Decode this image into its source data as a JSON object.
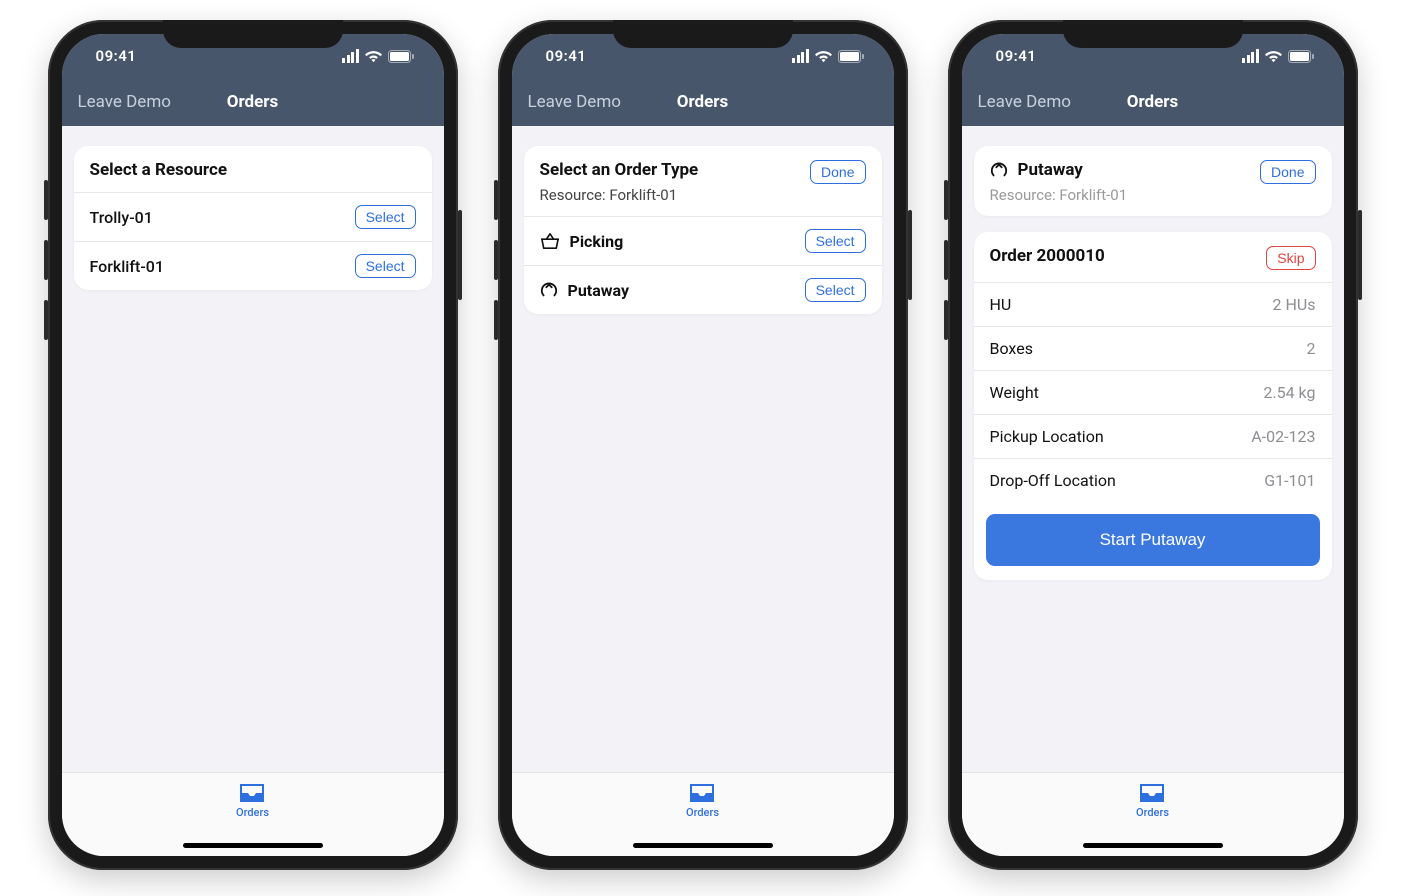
{
  "status": {
    "time": "09:41"
  },
  "nav": {
    "back": "Leave Demo",
    "title": "Orders"
  },
  "tab": {
    "label": "Orders"
  },
  "colors": {
    "accent": "#2e6fe0",
    "danger": "#e0443e",
    "navBg": "#48566b"
  },
  "screen1": {
    "title": "Select a Resource",
    "items": [
      {
        "label": "Trolly-01",
        "action": "Select"
      },
      {
        "label": "Forklift-01",
        "action": "Select"
      }
    ]
  },
  "screen2": {
    "title": "Select an Order Type",
    "resourceLine": "Resource: Forklift-01",
    "done": "Done",
    "types": [
      {
        "icon": "basket",
        "label": "Picking",
        "action": "Select"
      },
      {
        "icon": "putaway",
        "label": "Putaway",
        "action": "Select"
      }
    ]
  },
  "screen3": {
    "type": {
      "icon": "putaway",
      "label": "Putaway"
    },
    "resourceLine": "Resource: Forklift-01",
    "done": "Done",
    "orderTitle": "Order 2000010",
    "skip": "Skip",
    "rows": [
      {
        "label": "HU",
        "value": "2 HUs"
      },
      {
        "label": "Boxes",
        "value": "2"
      },
      {
        "label": "Weight",
        "value": "2.54 kg"
      },
      {
        "label": "Pickup Location",
        "value": "A-02-123"
      },
      {
        "label": "Drop-Off Location",
        "value": "G1-101"
      }
    ],
    "primary": "Start Putaway"
  }
}
